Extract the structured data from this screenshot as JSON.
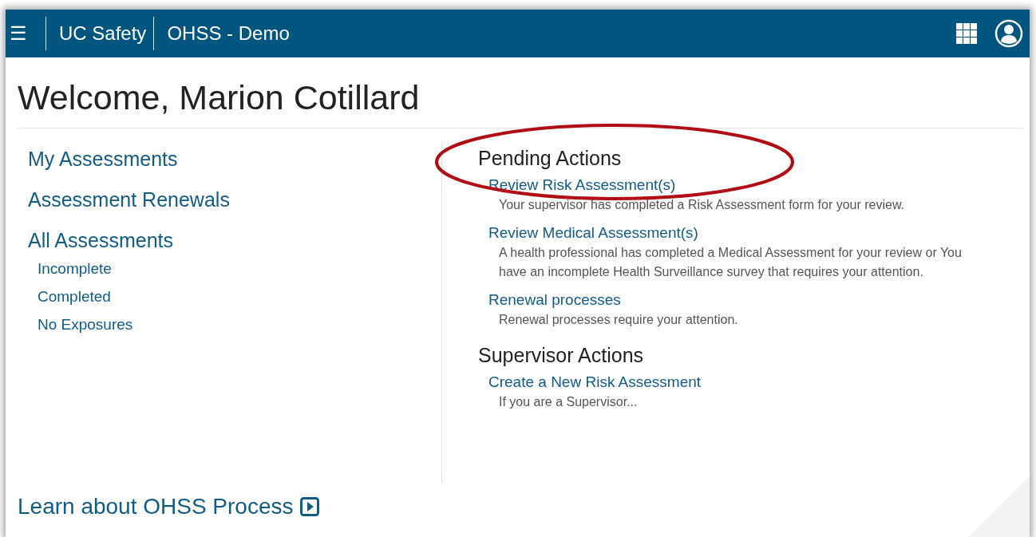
{
  "header": {
    "menu_icon": "☰",
    "brand": "UC Safety",
    "app": "OHSS - Demo"
  },
  "title": "Welcome, Marion Cotillard",
  "nav": [
    {
      "label": "My Assessments"
    },
    {
      "label": "Assessment Renewals"
    },
    {
      "label": "All Assessments",
      "children": [
        {
          "label": "Incomplete"
        },
        {
          "label": "Completed"
        },
        {
          "label": "No Exposures"
        }
      ]
    }
  ],
  "sections": [
    {
      "heading": "Pending Actions",
      "highlighted": true,
      "items": [
        {
          "link": "Review Risk Assessment(s)",
          "description": "Your supervisor has completed a Risk Assessment form for your review."
        },
        {
          "link": "Review Medical Assessment(s)",
          "description": "A health professional has completed a Medical Assessment for your review or You have an incomplete Health Surveillance survey that requires your attention."
        },
        {
          "link": "Renewal processes",
          "description": "Renewal processes require your attention."
        }
      ]
    },
    {
      "heading": "Supervisor Actions",
      "highlighted": false,
      "items": [
        {
          "link": "Create a New Risk Assessment",
          "description": "If you are a Supervisor..."
        }
      ]
    }
  ],
  "learn_link": "Learn about OHSS Process"
}
